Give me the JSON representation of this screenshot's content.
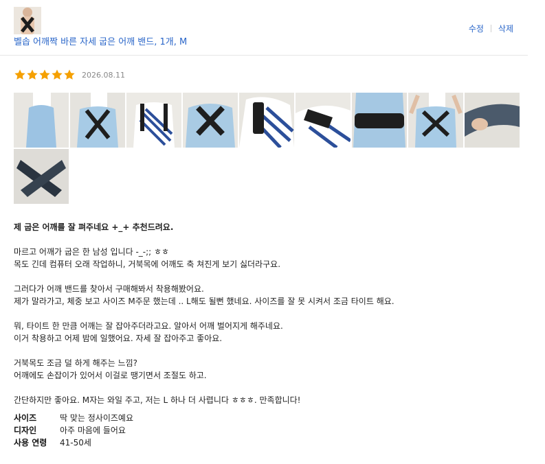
{
  "product": {
    "name": "벨솝 어깨짝 바른 자세 굽은 어깨 밴드, 1개, M",
    "thumbnail_icon": "product-photo"
  },
  "actions": {
    "edit_label": "수정",
    "delete_label": "삭제"
  },
  "review": {
    "rating": 5,
    "rating_max": 5,
    "date": "2026.08.11",
    "star_color": "#f5a000",
    "headline": "제 굽은 어깨를 잘 펴주네요 +_+ 추천드려요.",
    "paragraphs": [
      "마르고 어깨가 굽은 한 남성 입니다 -_-;; ㅎㅎ\n목도 긴데 컴퓨터 오래 작업하니, 거북목에 어깨도 축 쳐진게 보기 싫더라구요.",
      "그러다가 어깨 밴드를 찾아서 구매해봐서 착용해봤어요.\n제가 말라가고, 체중 보고 사이즈 M주문 했는데 .. L해도 될뻔 했네요. 사이즈를 잘 못 시켜서 조금 타이트 해요.",
      "뭐, 타이트 한 만큼 어깨는 잘 잡아주더라고요. 알아서 어깨 벌어지게 해주네요.\n이거 착용하고 어제 밤에 일했어요. 자세 잘 잡아주고 좋아요.",
      "거북목도 조금 덜 하게 해주는 느낌?\n어깨에도 손잡이가 있어서 이걸로 땡기면서 조절도 하고.",
      "간단하지만 좋아요. M자는 와일 주고, 저는 L 하나 더 사렵니다 ㅎㅎㅎ. 만족합니다!"
    ],
    "photos": [
      {
        "icon": "photo-side-view-shirt"
      },
      {
        "icon": "photo-back-view-band"
      },
      {
        "icon": "photo-front-view-striped"
      },
      {
        "icon": "photo-back-cross-band"
      },
      {
        "icon": "photo-band-handle-closeup"
      },
      {
        "icon": "photo-shoulder-closeup"
      },
      {
        "icon": "photo-waist-strap"
      },
      {
        "icon": "photo-arms-raised"
      },
      {
        "icon": "photo-band-grey-hand"
      },
      {
        "icon": "photo-band-flat"
      }
    ],
    "attributes": [
      {
        "label": "사이즈",
        "value": "딱 맞는 정사이즈예요"
      },
      {
        "label": "디자인",
        "value": "아주 마음에 들어요"
      },
      {
        "label": "사용 연령",
        "value": "41-50세"
      }
    ]
  }
}
